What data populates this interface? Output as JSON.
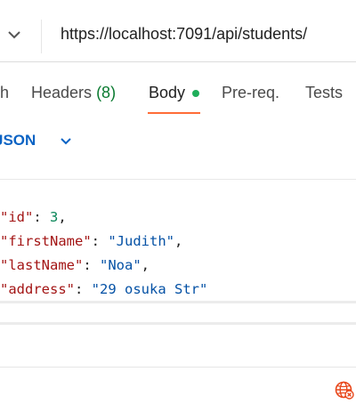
{
  "request": {
    "url": "https://localhost:7091/api/students/",
    "method_icon": "chevron-down-icon"
  },
  "tabs": {
    "partial": "h",
    "headers_label": "Headers",
    "headers_count": "(8)",
    "body_label": "Body",
    "prereq_label": "Pre-req.",
    "tests_label": "Tests",
    "active": "Body",
    "accent_color": "#ff6c37",
    "status_dot_color": "#1fae5a"
  },
  "body_type": {
    "label": "JSON",
    "icon": "chevron-down-icon",
    "color": "#0b63c4"
  },
  "editor": {
    "lines": [
      {
        "key": "\"id\"",
        "sep": ": ",
        "value": "3",
        "end": ","
      },
      {
        "key": "\"firstName\"",
        "sep": ": ",
        "value": "\"Judith\"",
        "end": ","
      },
      {
        "key": "\"lastName\"",
        "sep": ": ",
        "value": "\"Noa\"",
        "end": ","
      },
      {
        "key": "\"address\"",
        "sep": ": ",
        "value": "\"29 osuka Str\"",
        "end": ""
      }
    ]
  },
  "footer": {
    "icon": "globe-error-icon",
    "icon_color": "#e8481c"
  }
}
